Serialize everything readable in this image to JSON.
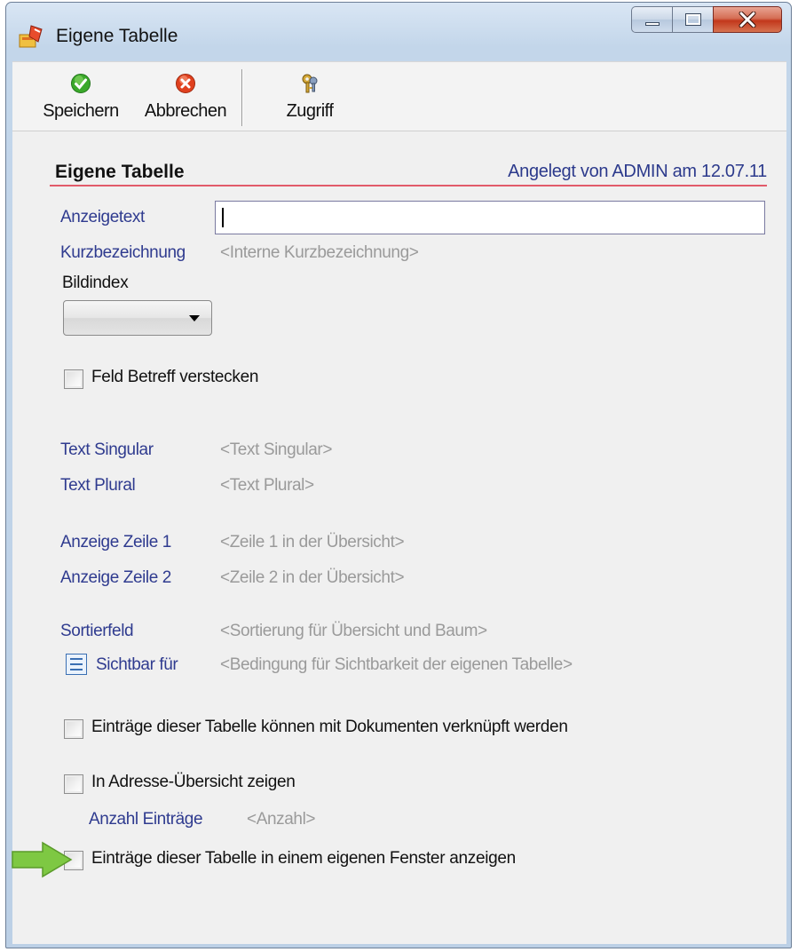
{
  "window": {
    "title": "Eigene Tabelle"
  },
  "toolbar": {
    "save_label": "Speichern",
    "cancel_label": "Abbrechen",
    "access_label": "Zugriff",
    "icons": {
      "save": "check-circle-icon",
      "cancel": "x-circle-icon",
      "access": "keys-icon"
    }
  },
  "section": {
    "title": "Eigene Tabelle",
    "created_info": "Angelegt von ADMIN am 12.07.11"
  },
  "form": {
    "display_text_label": "Anzeigetext",
    "display_text_value": "",
    "short_name_label": "Kurzbezeichnung",
    "short_name_placeholder": "<Interne Kurzbezeichnung>",
    "image_index_label": "Bildindex",
    "image_index_value": "",
    "hide_subject_label": "Feld Betreff verstecken",
    "hide_subject_checked": false,
    "text_singular_label": "Text Singular",
    "text_singular_placeholder": "<Text Singular>",
    "text_plural_label": "Text Plural",
    "text_plural_placeholder": "<Text Plural>",
    "line1_label": "Anzeige Zeile 1",
    "line1_placeholder": "<Zeile 1 in der Übersicht>",
    "line2_label": "Anzeige Zeile 2",
    "line2_placeholder": "<Zeile 2 in der Übersicht>",
    "sort_field_label": "Sortierfeld",
    "sort_field_placeholder": "<Sortierung für Übersicht und Baum>",
    "visible_for_label": "Sichtbar für",
    "visible_for_placeholder": "<Bedingung für Sichtbarkeit der eigenen Tabelle>",
    "link_documents_label": "Einträge dieser Tabelle können mit Dokumenten verknüpft werden",
    "link_documents_checked": false,
    "show_in_address_label": "In Adresse-Übersicht zeigen",
    "show_in_address_checked": false,
    "entry_count_label": "Anzahl Einträge",
    "entry_count_placeholder": "<Anzahl>",
    "own_window_label": "Einträge dieser Tabelle in einem eigenen Fenster anzeigen",
    "own_window_checked": false
  },
  "colors": {
    "label_blue": "#2f3b8f",
    "placeholder_grey": "#9a9a9a",
    "accent_line": "#e25b6a",
    "arrow_green": "#7ec843"
  }
}
